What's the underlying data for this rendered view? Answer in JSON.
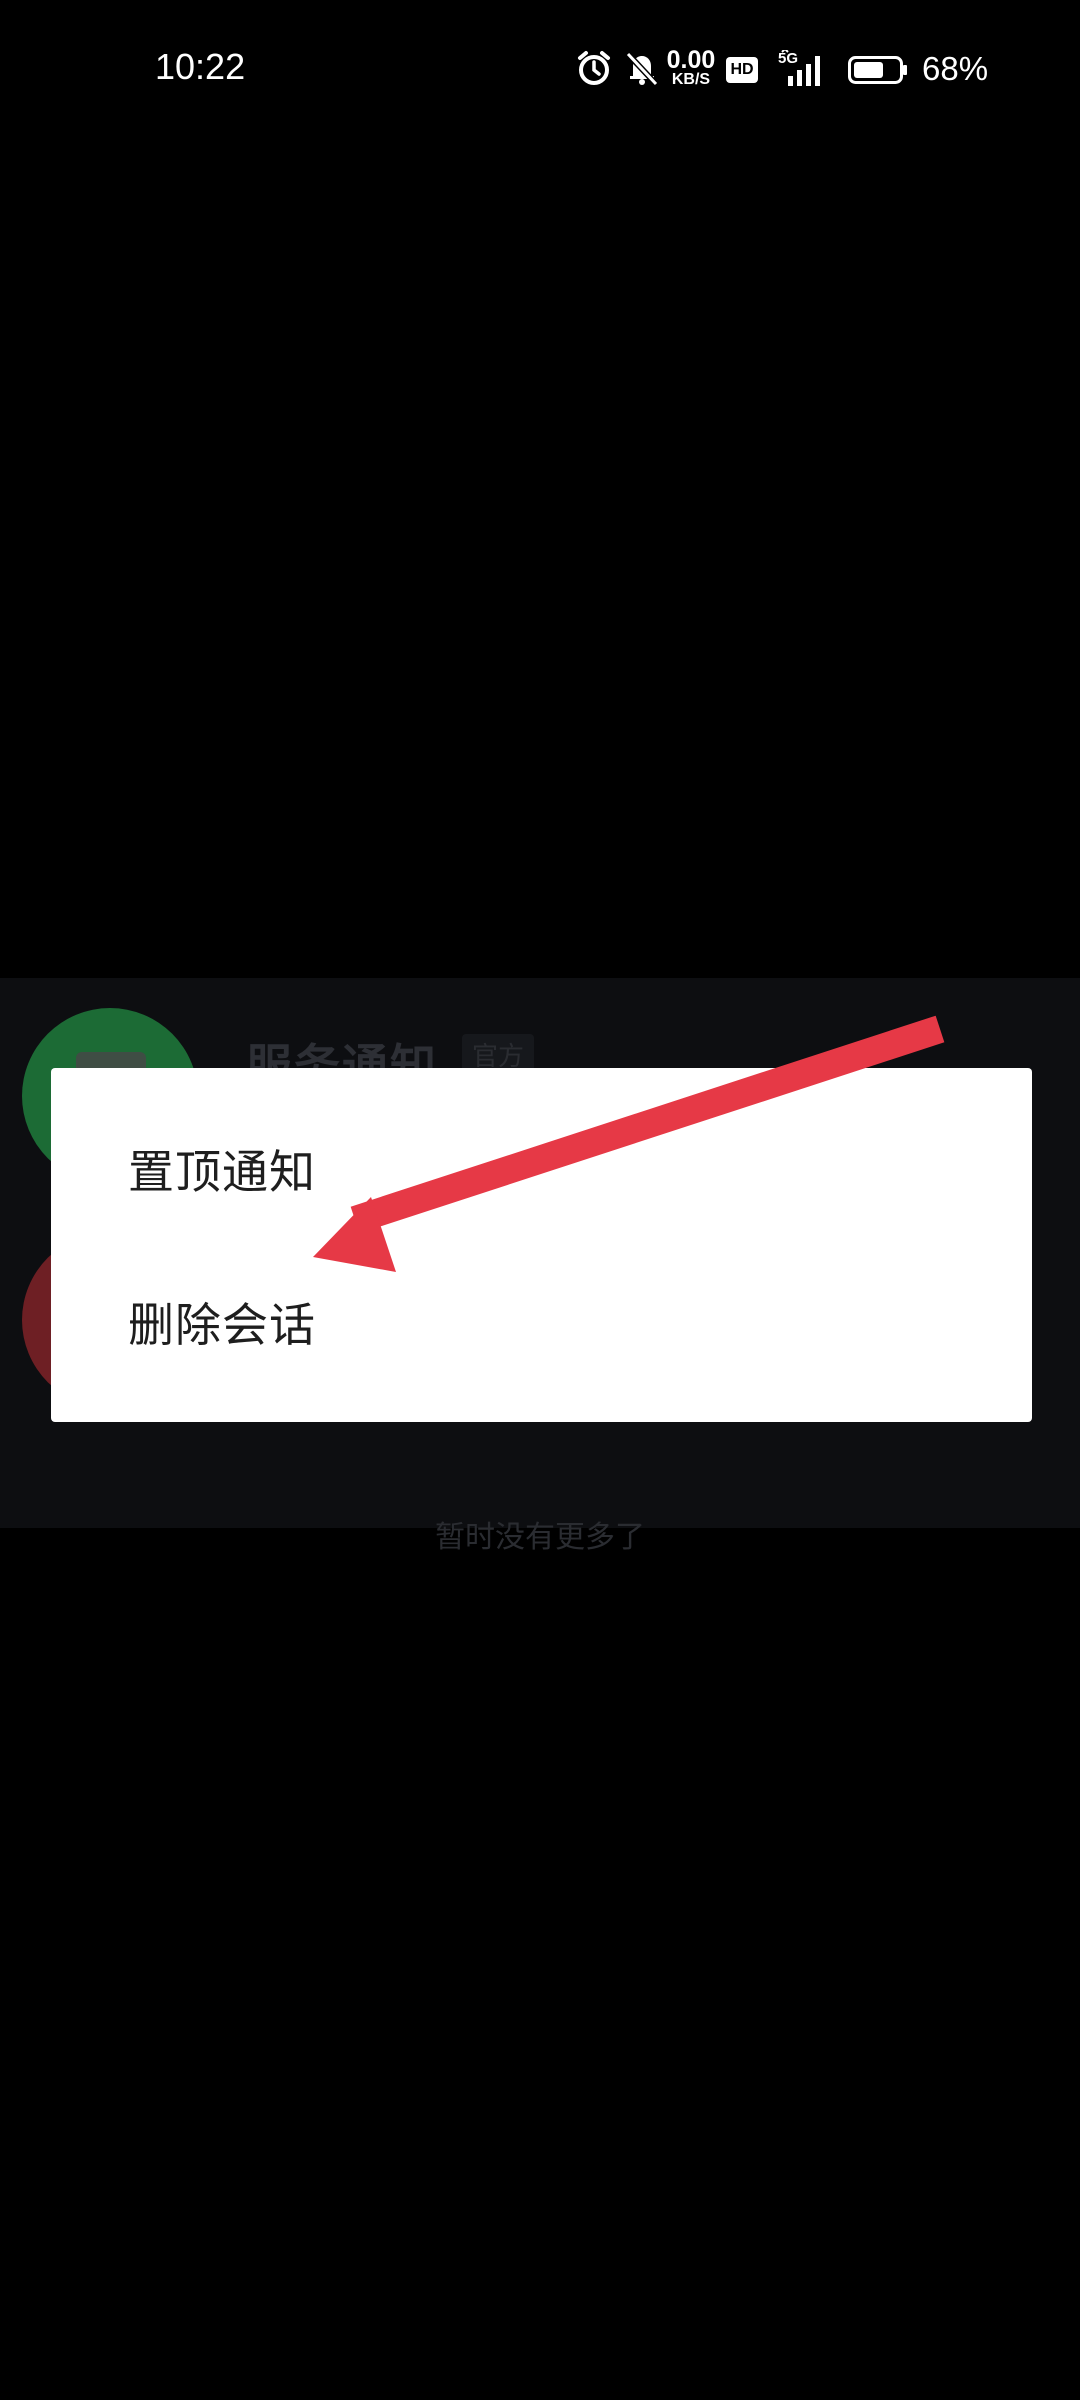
{
  "status_bar": {
    "time": "10:22",
    "net_speed_value": "0.00",
    "net_speed_unit": "KB/S",
    "hd_label": "HD",
    "network_type": "5G",
    "battery_percent": "68%",
    "battery_level": 0.68,
    "icons": [
      "alarm-icon",
      "mute-bell-icon",
      "signal-icon",
      "battery-icon"
    ]
  },
  "background_list": {
    "item_title": "服务通知",
    "item_badge": "官方",
    "footer_text": "暂时没有更多了"
  },
  "context_menu": {
    "items": [
      {
        "label": "置顶通知"
      },
      {
        "label": "删除会话"
      }
    ]
  },
  "annotation": {
    "arrow_color": "#e63946"
  }
}
